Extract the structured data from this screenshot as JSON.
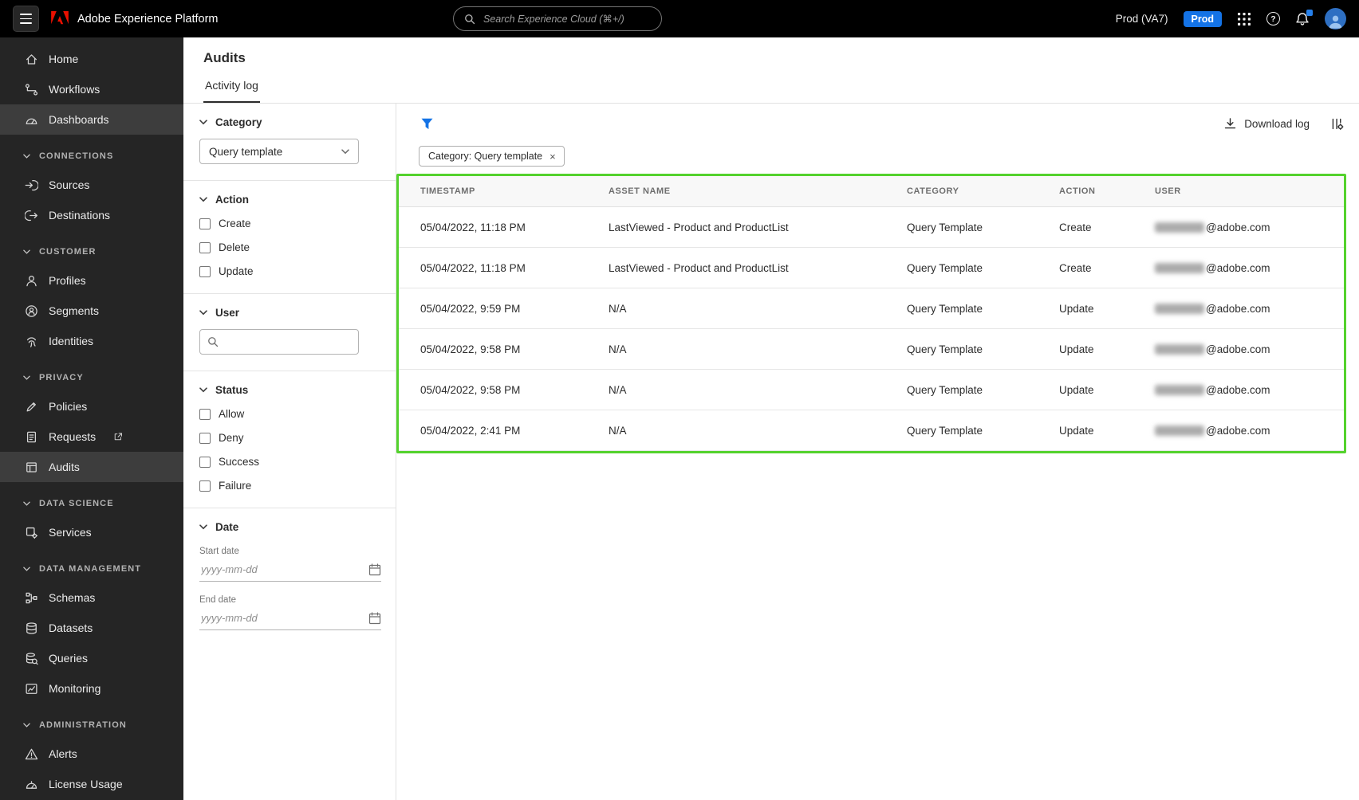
{
  "colors": {
    "accent": "#1473e6",
    "adobe_red": "#eb1000",
    "annotation_green": "#54d22d"
  },
  "topbar": {
    "app_name": "Adobe Experience Platform",
    "search_placeholder": "Search Experience Cloud (⌘+/)",
    "environment_label": "Prod (VA7)",
    "environment_badge": "Prod"
  },
  "icons": {
    "help_glyph": "?",
    "chip_close": "×"
  },
  "sidebar": {
    "primary": [
      {
        "label": "Home"
      },
      {
        "label": "Workflows"
      },
      {
        "label": "Dashboards"
      }
    ],
    "sections": [
      {
        "title": "CONNECTIONS",
        "items": [
          {
            "label": "Sources"
          },
          {
            "label": "Destinations"
          }
        ]
      },
      {
        "title": "CUSTOMER",
        "items": [
          {
            "label": "Profiles"
          },
          {
            "label": "Segments"
          },
          {
            "label": "Identities"
          }
        ]
      },
      {
        "title": "PRIVACY",
        "items": [
          {
            "label": "Policies"
          },
          {
            "label": "Requests"
          },
          {
            "label": "Audits"
          }
        ]
      },
      {
        "title": "DATA SCIENCE",
        "items": [
          {
            "label": "Services"
          }
        ]
      },
      {
        "title": "DATA MANAGEMENT",
        "items": [
          {
            "label": "Schemas"
          },
          {
            "label": "Datasets"
          },
          {
            "label": "Queries"
          },
          {
            "label": "Monitoring"
          }
        ]
      },
      {
        "title": "ADMINISTRATION",
        "items": [
          {
            "label": "Alerts"
          },
          {
            "label": "License Usage"
          }
        ]
      }
    ]
  },
  "page": {
    "title": "Audits",
    "active_tab": "Activity log"
  },
  "filters": {
    "category": {
      "title": "Category",
      "selected_value": "Query template"
    },
    "action": {
      "title": "Action",
      "options": [
        "Create",
        "Delete",
        "Update"
      ]
    },
    "user": {
      "title": "User",
      "search_placeholder": ""
    },
    "status": {
      "title": "Status",
      "options": [
        "Allow",
        "Deny",
        "Success",
        "Failure"
      ]
    },
    "date": {
      "title": "Date",
      "start_label": "Start date",
      "end_label": "End date",
      "date_placeholder": "yyyy-mm-dd"
    }
  },
  "toolbar": {
    "download_label": "Download log"
  },
  "chips": [
    {
      "label": "Category: Query template"
    }
  ],
  "table": {
    "columns": [
      "TIMESTAMP",
      "ASSET NAME",
      "CATEGORY",
      "ACTION",
      "USER"
    ],
    "rows": [
      {
        "timestamp": "05/04/2022, 11:18 PM",
        "asset_name": "LastViewed - Product and ProductList",
        "category": "Query Template",
        "action": "Create",
        "user_domain": "@adobe.com"
      },
      {
        "timestamp": "05/04/2022, 11:18 PM",
        "asset_name": "LastViewed - Product and ProductList",
        "category": "Query Template",
        "action": "Create",
        "user_domain": "@adobe.com"
      },
      {
        "timestamp": "05/04/2022, 9:59 PM",
        "asset_name": "N/A",
        "category": "Query Template",
        "action": "Update",
        "user_domain": "@adobe.com"
      },
      {
        "timestamp": "05/04/2022, 9:58 PM",
        "asset_name": "N/A",
        "category": "Query Template",
        "action": "Update",
        "user_domain": "@adobe.com"
      },
      {
        "timestamp": "05/04/2022, 9:58 PM",
        "asset_name": "N/A",
        "category": "Query Template",
        "action": "Update",
        "user_domain": "@adobe.com"
      },
      {
        "timestamp": "05/04/2022, 2:41 PM",
        "asset_name": "N/A",
        "category": "Query Template",
        "action": "Update",
        "user_domain": "@adobe.com"
      }
    ]
  }
}
